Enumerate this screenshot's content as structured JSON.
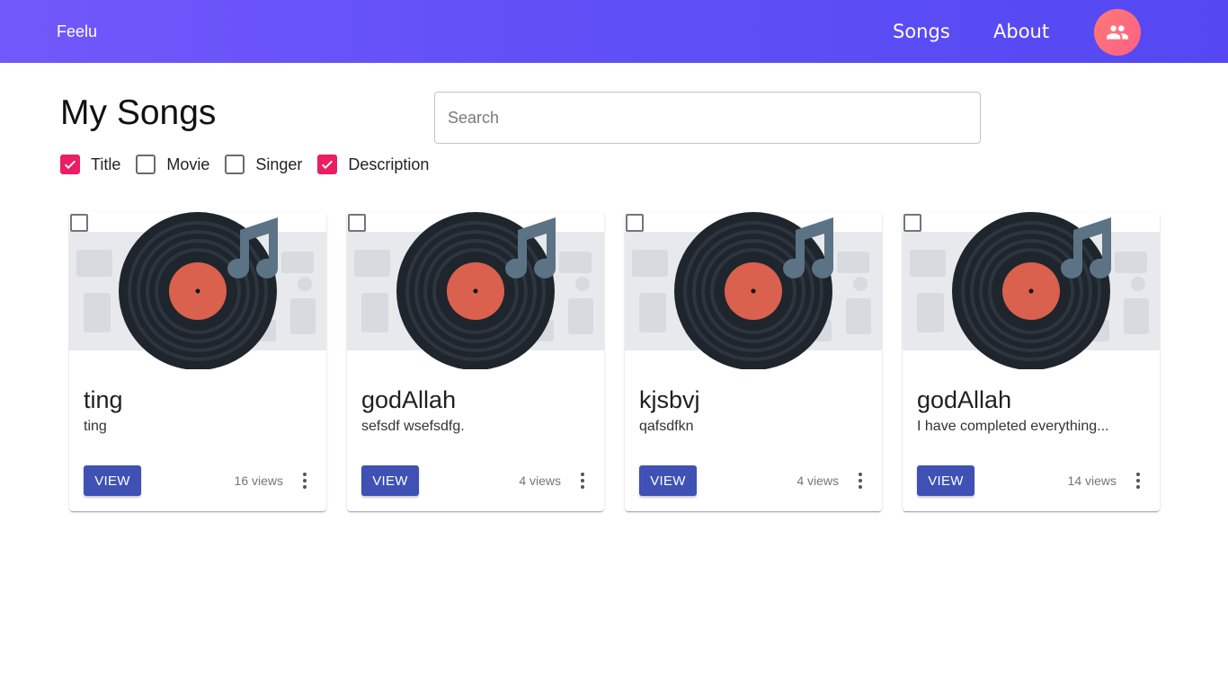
{
  "header": {
    "brand": "Feelu",
    "nav": [
      {
        "label": "Songs"
      },
      {
        "label": "About"
      }
    ],
    "avatar_icon": "people-icon",
    "gradient": [
      "#7158fb",
      "#5548f2"
    ]
  },
  "page": {
    "title": "My Songs",
    "search": {
      "placeholder": "Search",
      "value": ""
    }
  },
  "filters": [
    {
      "label": "Title",
      "checked": true
    },
    {
      "label": "Movie",
      "checked": false
    },
    {
      "label": "Singer",
      "checked": false
    },
    {
      "label": "Description",
      "checked": true
    }
  ],
  "songs": [
    {
      "title": "ting",
      "description": "ting",
      "button": "VIEW",
      "views": "16 views",
      "selected": false
    },
    {
      "title": "godAllah",
      "description": "sefsdf wsefsdfg.",
      "button": "VIEW",
      "views": "4 views",
      "selected": false
    },
    {
      "title": "kjsbvj",
      "description": "qafsdfkn",
      "button": "VIEW",
      "views": "4 views",
      "selected": false
    },
    {
      "title": "godAllah",
      "description": "I have completed everything...",
      "button": "VIEW",
      "views": "14 views",
      "selected": false
    }
  ],
  "colors": {
    "accent": "#e91e63",
    "primary_button": "#3f51b5",
    "record": "#1f252d",
    "record_label": "#d9614d",
    "note": "#5c7385"
  }
}
